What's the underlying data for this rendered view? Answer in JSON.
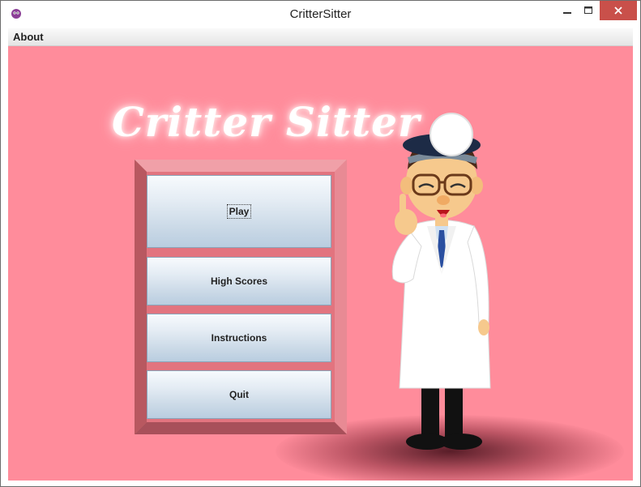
{
  "window": {
    "title": "CritterSitter"
  },
  "menubar": {
    "items": [
      {
        "label": "About"
      }
    ]
  },
  "logo": {
    "text": "Critter Sitter"
  },
  "main_menu": {
    "buttons": [
      {
        "label": "Play"
      },
      {
        "label": "High Scores"
      },
      {
        "label": "Instructions"
      },
      {
        "label": "Quit"
      }
    ]
  },
  "colors": {
    "background": "#ff8c9b",
    "frame": "#d9707a",
    "close_button": "#c9504a"
  },
  "icons": {
    "app": "critter-face-icon",
    "minimize": "minimize-icon",
    "maximize": "maximize-icon",
    "close": "close-icon"
  }
}
